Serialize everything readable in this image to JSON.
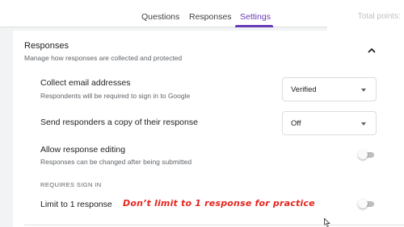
{
  "tabs": [
    "Questions",
    "Responses",
    "Settings"
  ],
  "active_tab": "Settings",
  "total_points": "Total points: ",
  "colors": {
    "accent": "#673ab7",
    "annotation": "#e5261f",
    "toggle_off": "#bdbdbd"
  },
  "section": {
    "title": "Responses",
    "subtitle": "Manage how responses are collected and protected",
    "chevron_icon": "chevron-up-icon"
  },
  "settings": {
    "collect_email": {
      "title": "Collect email addresses",
      "subtitle": "Respondents will be required to sign in to Google",
      "value": "Verified"
    },
    "send_copy": {
      "title": "Send responders a copy of their response",
      "value": "Off"
    },
    "allow_editing": {
      "title": "Allow response editing",
      "subtitle": "Responses can be changed after being submitted",
      "enabled": false
    },
    "requires_sign_in_label": "REQUIRES SIGN IN",
    "limit_one": {
      "title": "Limit to 1 response",
      "enabled": false
    }
  },
  "annotation": "Don’t limit to 1 response for practice"
}
